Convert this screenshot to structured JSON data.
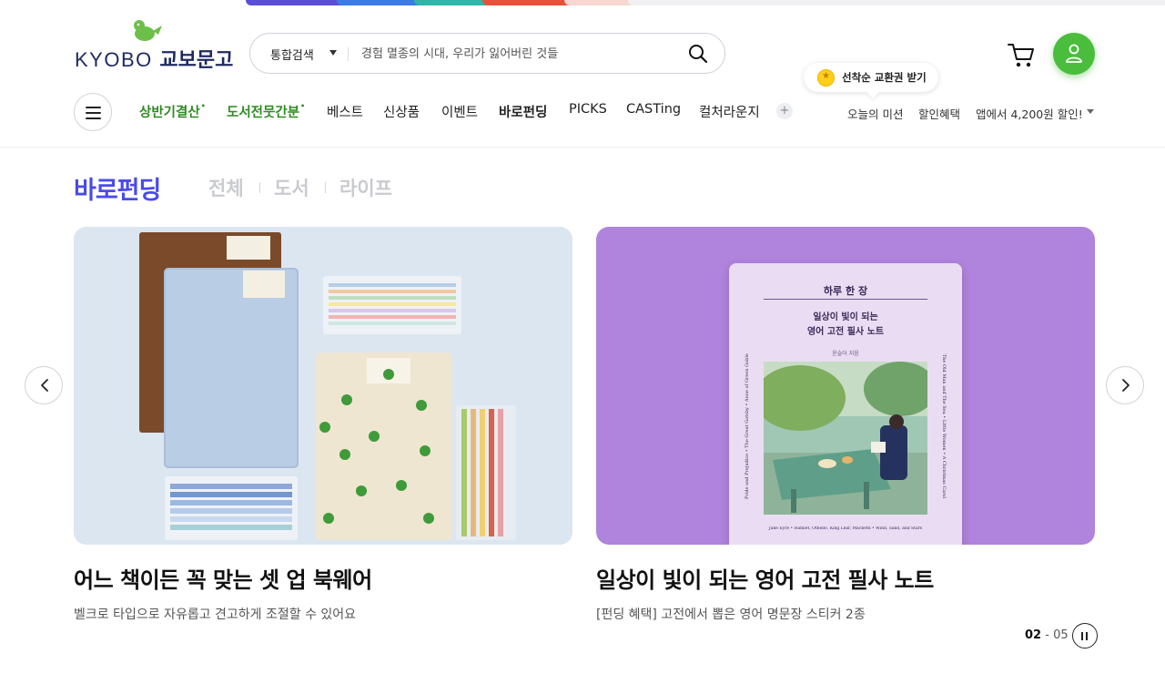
{
  "colors": {
    "brand_navy": "#1e2a5e",
    "brand_green": "#4bbd3c",
    "nav_green": "#2e8b21",
    "section_blue": "#4a4be8",
    "card2_bg": "#b083dc",
    "top_strip": [
      "#5a4fd6",
      "#3a7be8",
      "#2fb6a8",
      "#e8503a"
    ]
  },
  "header": {
    "logo": {
      "wordmark": "KYOBO",
      "korean": "교보문고",
      "icon": "bird-logo-icon"
    },
    "search": {
      "scope_label": "통합검색",
      "placeholder": "경험 멸종의 시대, 우리가 잃어버린 것들",
      "icon": "search-icon"
    },
    "cart_icon": "cart-icon",
    "user_icon": "user-icon"
  },
  "nav": {
    "menu_icon": "hamburger-icon",
    "items": [
      {
        "label": "상반기결산",
        "mark": "•"
      },
      {
        "label": "도서전뭇간분",
        "mark": "•"
      },
      {
        "label": "베스트"
      },
      {
        "label": "신상품"
      },
      {
        "label": "이벤트"
      },
      {
        "label": "바로펀딩"
      },
      {
        "label": "PICKS"
      },
      {
        "label": "CASTing"
      },
      {
        "label": "컬처라운지"
      }
    ],
    "more": "+",
    "bubble": "선착순 교환권 받기",
    "util": [
      "오늘의 미션",
      "할인혜택",
      "앱에서 4,200원 할인!"
    ]
  },
  "section": {
    "title": "바로펀딩",
    "tabs": [
      "전체",
      "도서",
      "라이프"
    ]
  },
  "cards": [
    {
      "title": "어느 책이든 꼭 맞는 셋 업 북웨어",
      "desc": "벨크로 타입으로 자유롭고 견고하게 조절할 수 있어요"
    },
    {
      "title": "일상이 빛이 되는 영어 고전 필사 노트",
      "desc": "[펀딩 혜택] 고전에서 뽑은 영어 명문장 스티커 2종",
      "book": {
        "top": "하루 한 장",
        "line1": "일상이 빛이 되는",
        "line2": "영어 고전 필사 노트",
        "author": "윤슬아 지음",
        "spine_left": "Pride and Prejudice • The Great Gatsby • Anne of Green Gables",
        "spine_right": "The Old Man and The Sea • Little Women • A Christmas Carol",
        "bottom": "Jane Eyre • Hamlet, Othello, King Lear, Macbeth • Wind, Sand, and Stars"
      }
    }
  ],
  "pager": {
    "current": "02",
    "sep": "-",
    "total": "05"
  }
}
